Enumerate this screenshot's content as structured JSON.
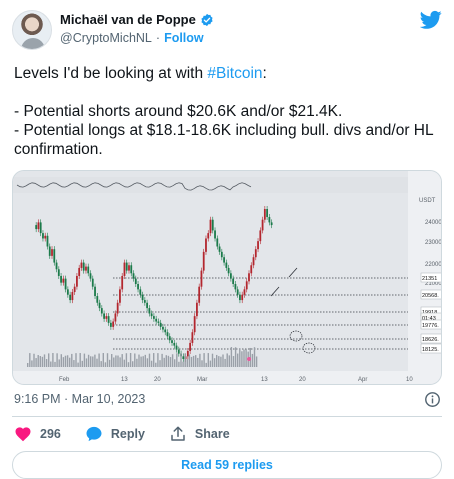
{
  "author": {
    "name": "Michaël van de Poppe",
    "handle": "@CryptoMichNL",
    "separator": "·",
    "follow_label": "Follow"
  },
  "tweet": {
    "line1_prefix": "Levels I'd be looking at with ",
    "hashtag": "#Bitcoin",
    "line1_suffix": ":",
    "line2": "- Potential shorts around $20.6K and/or $21.4K.",
    "line3": "- Potential longs at $18.1-18.6K including bull. divs and/or HL confirmation."
  },
  "chart": {
    "top_label": "USDT",
    "price_ticks": [
      "24000.",
      "23000.",
      "22000.",
      "21000."
    ],
    "level_tags": [
      "21351",
      "20568.",
      "19918.",
      "01:43",
      "19776.",
      "18626.",
      "18125."
    ],
    "x_ticks": [
      "Feb",
      "13",
      "20",
      "Mar",
      "13",
      "20",
      "Apr",
      "10"
    ],
    "colors": {
      "up": "#1b7a4a",
      "down": "#b3262e",
      "bg": "#e3e6ea",
      "level": "#3a3f47"
    }
  },
  "meta": {
    "timestamp": "9:16 PM · Mar 10, 2023"
  },
  "actions": {
    "like_count": "296",
    "reply_label": "Reply",
    "share_label": "Share"
  },
  "replies": {
    "label": "Read 59 replies"
  },
  "icons": {
    "verified": "verified-badge-icon",
    "twitter": "twitter-bird-icon",
    "info": "info-icon",
    "like": "heart-icon",
    "reply": "speech-bubble-icon",
    "share": "share-arrow-icon"
  }
}
